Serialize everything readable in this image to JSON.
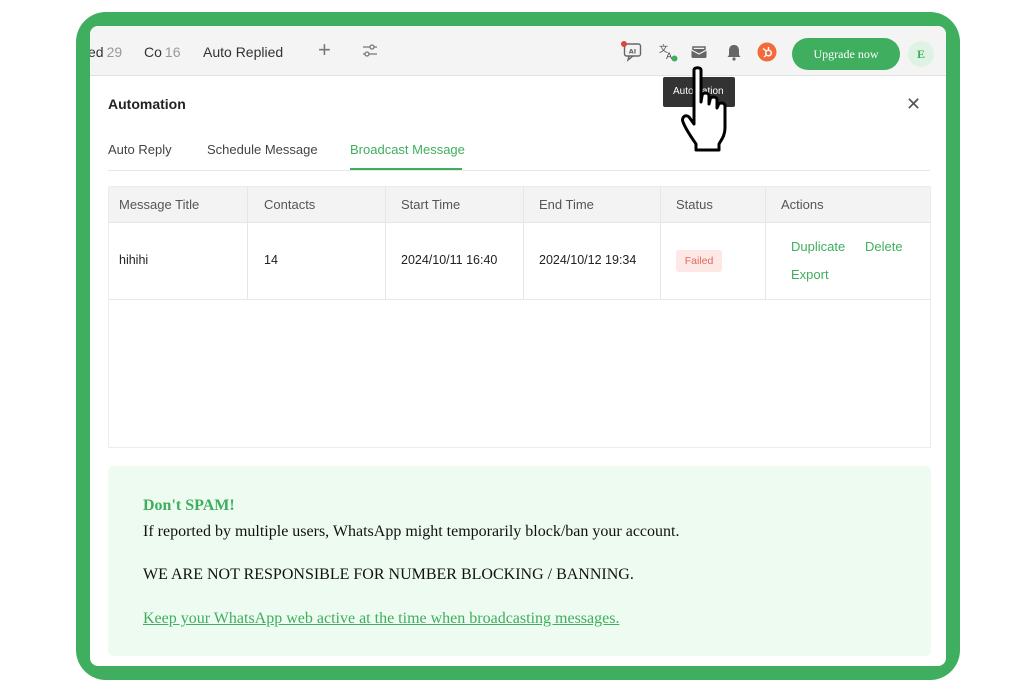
{
  "topbar": {
    "chips": [
      {
        "label": "ed",
        "count": "29"
      },
      {
        "label": "Co",
        "count": "16"
      },
      {
        "label": "Auto Replied",
        "count": ""
      }
    ],
    "ai_icon_text": "AI",
    "upgrade_label": "Upgrade now",
    "avatar_letter": "E",
    "tooltip": "Automation"
  },
  "automation": {
    "title": "Automation",
    "tabs": [
      "Auto Reply",
      "Schedule Message",
      "Broadcast Message"
    ],
    "active_tab": "Broadcast Message"
  },
  "table": {
    "headers": [
      "Message Title",
      "Contacts",
      "Start Time",
      "End Time",
      "Status",
      "Actions"
    ],
    "rows": [
      {
        "title": "hihihi",
        "contacts": "14",
        "start": "2024/10/11 16:40",
        "end": "2024/10/12 19:34",
        "status": "Failed",
        "actions": [
          "Duplicate",
          "Delete",
          "Export"
        ]
      }
    ]
  },
  "notice": {
    "title": "Don't SPAM!",
    "line1": "If reported by multiple users, WhatsApp might temporarily block/ban your account.",
    "line2": "WE ARE NOT RESPONSIBLE FOR NUMBER BLOCKING / BANNING.",
    "link": "Keep your WhatsApp web active at the time when broadcasting messages."
  },
  "colors": {
    "accent": "#3fae5e",
    "status_failed_bg": "#fde8e6",
    "status_failed_text": "#e06a5e",
    "notice_bg": "#edfbf0"
  }
}
